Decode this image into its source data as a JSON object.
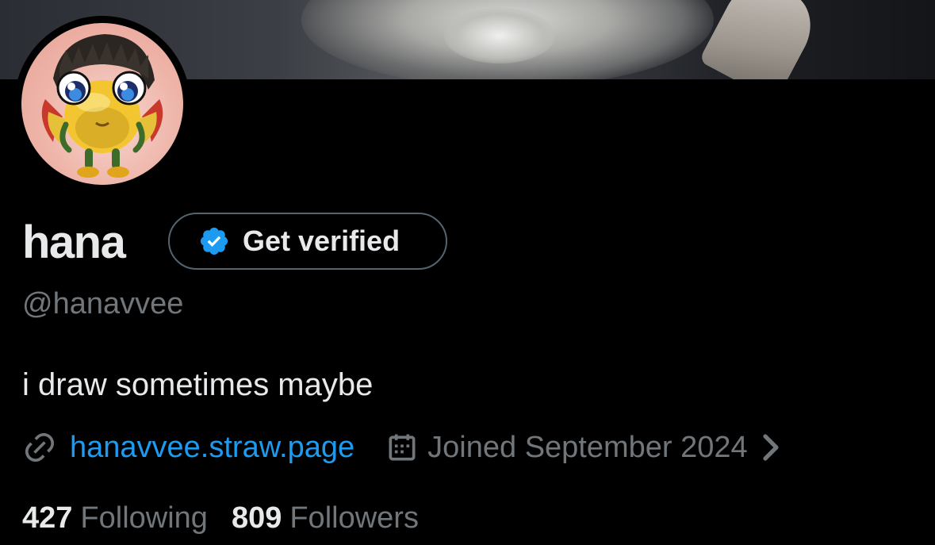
{
  "profile": {
    "display_name": "hana",
    "handle": "@hanavvee",
    "bio": "i draw sometimes maybe",
    "website": "hanavvee.straw.page",
    "joined": "Joined September 2024"
  },
  "verify_button": {
    "label": "Get verified"
  },
  "stats": {
    "following_count": "427",
    "following_label": "Following",
    "followers_count": "809",
    "followers_label": "Followers"
  },
  "colors": {
    "background": "#000000",
    "primary_text": "#e7e9ea",
    "secondary_text": "#71767b",
    "link": "#1d9bf0",
    "verified_badge": "#1d9bf0",
    "button_border": "#536471"
  },
  "icons": {
    "verified": "verified-badge-icon",
    "link": "link-icon",
    "calendar": "calendar-icon",
    "chevron": "chevron-right-icon"
  }
}
